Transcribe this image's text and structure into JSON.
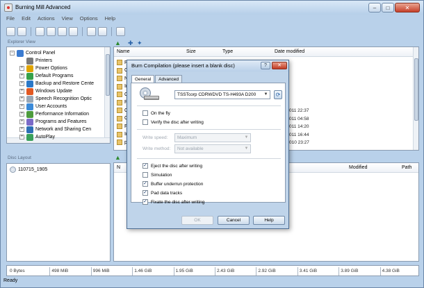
{
  "app": {
    "title": "Burning Mill Advanced"
  },
  "menu": [
    "File",
    "Edit",
    "Actions",
    "View",
    "Options",
    "Help"
  ],
  "explorer": {
    "label": "Explorer View",
    "tree": [
      {
        "label": "Control Panel",
        "level": 0,
        "expander": "−",
        "color": "#3b7bd0"
      },
      {
        "label": "Printers",
        "level": 1,
        "expander": "",
        "color": "#7a7a7a"
      },
      {
        "label": "Power Options",
        "level": 1,
        "expander": "+",
        "color": "#e0a400"
      },
      {
        "label": "Default Programs",
        "level": 1,
        "expander": "+",
        "color": "#36a14a"
      },
      {
        "label": "Backup and Restore Cente",
        "level": 1,
        "expander": "+",
        "color": "#2a78c8"
      },
      {
        "label": "Windows Update",
        "level": 1,
        "expander": "+",
        "color": "#e25822"
      },
      {
        "label": "Speech Recognition Optic",
        "level": 1,
        "expander": "+",
        "color": "#9aa7b5"
      },
      {
        "label": "User Accounts",
        "level": 1,
        "expander": "+",
        "color": "#3b8ad8"
      },
      {
        "label": "Performance Information",
        "level": 1,
        "expander": "+",
        "color": "#4d9b3c"
      },
      {
        "label": "Programs and Features",
        "level": 1,
        "expander": "+",
        "color": "#7b6ac8"
      },
      {
        "label": "Network and Sharing Cen",
        "level": 1,
        "expander": "+",
        "color": "#2d6fb5"
      },
      {
        "label": "AutoPlay",
        "level": 1,
        "expander": "+",
        "color": "#39a05a"
      }
    ],
    "columns": {
      "name": "Name",
      "size": "Size",
      "type": "Type",
      "date": "Date modified"
    },
    "files": [
      {
        "name": "P",
        "date": ""
      },
      {
        "name": "C",
        "date": ""
      },
      {
        "name": "N",
        "date": ""
      },
      {
        "name": "In",
        "date": ""
      },
      {
        "name": "C",
        "date": ""
      },
      {
        "name": "Re",
        "date": ""
      },
      {
        "name": "C",
        "date": "011 22:37"
      },
      {
        "name": "C",
        "date": "011 04:58"
      },
      {
        "name": "Fi",
        "date": "011 14:20"
      },
      {
        "name": "In",
        "date": "011 16:44"
      },
      {
        "name": "pt",
        "date": "010 23:27"
      }
    ]
  },
  "disc_layout": {
    "label": "Disc Layout",
    "item": "110715_1905",
    "columns": {
      "name": "N",
      "modified": "Modified",
      "path": "Path"
    }
  },
  "size_ticks": [
    "0 Bytes",
    "498 MiB",
    "996 MiB",
    "1.46 GiB",
    "1.95 GiB",
    "2.43 GiB",
    "2.92 GiB",
    "3.41 GiB",
    "3.89 GiB",
    "4.38 GiB"
  ],
  "status": "Ready",
  "dialog": {
    "title": "Burn Compilation (please insert a blank disc)",
    "help_glyph": "?",
    "close_glyph": "✕",
    "tabs": [
      "General",
      "Advanced"
    ],
    "drive": "TSSTcorp CDRWDVD TS-H493A D200",
    "options": [
      {
        "label": "On the fly",
        "checked": false
      },
      {
        "label": "Verify the disc after writing",
        "checked": false
      }
    ],
    "write_speed_label": "Write speed:",
    "write_speed": "Maximum",
    "write_method_label": "Write method:",
    "write_method": "Not available",
    "after": [
      {
        "label": "Eject the disc after writing",
        "checked": true
      },
      {
        "label": "Simulation",
        "checked": false
      },
      {
        "label": "Buffer underrun protection",
        "checked": true
      },
      {
        "label": "Pad data tracks",
        "checked": true
      },
      {
        "label": "Fixate the disc after writing",
        "checked": true
      }
    ],
    "buttons": {
      "ok": "OK",
      "cancel": "Cancel",
      "help": "Help"
    }
  }
}
